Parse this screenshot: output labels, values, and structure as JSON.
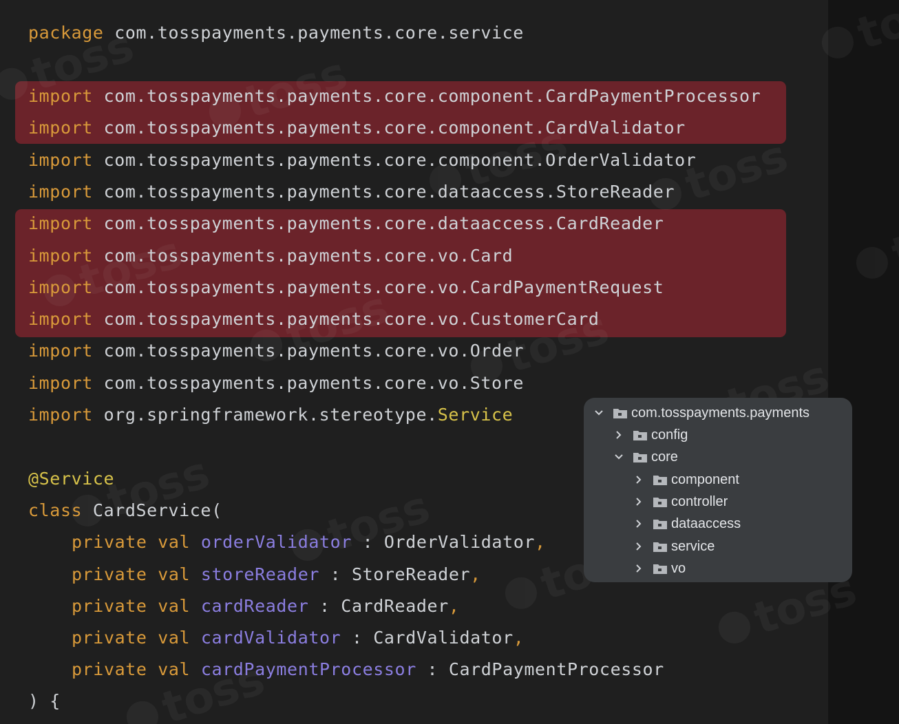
{
  "code": {
    "package_kw": "package",
    "package_name": " com.tosspayments.payments.core.service",
    "imports": [
      {
        "kw": "import",
        "path": " com.tosspayments.payments.core.component.CardPaymentProcessor"
      },
      {
        "kw": "import",
        "path": " com.tosspayments.payments.core.component.CardValidator"
      },
      {
        "kw": "import",
        "path": " com.tosspayments.payments.core.component.OrderValidator"
      },
      {
        "kw": "import",
        "path": " com.tosspayments.payments.core.dataaccess.StoreReader"
      },
      {
        "kw": "import",
        "path": " com.tosspayments.payments.core.dataaccess.CardReader"
      },
      {
        "kw": "import",
        "path": " com.tosspayments.payments.core.vo.Card"
      },
      {
        "kw": "import",
        "path": " com.tosspayments.payments.core.vo.CardPaymentRequest"
      },
      {
        "kw": "import",
        "path": " com.tosspayments.payments.core.vo.CustomerCard"
      },
      {
        "kw": "import",
        "path": " com.tosspayments.payments.core.vo.Order"
      },
      {
        "kw": "import",
        "path": " com.tosspayments.payments.core.vo.Store"
      }
    ],
    "last_import": {
      "kw": "import",
      "path": " org.springframework.stereotype.",
      "annotation": "Service"
    },
    "annotation": "@Service",
    "class_kw": "class",
    "class_decl": " CardService(",
    "params": [
      {
        "mods": "private val",
        "name": "orderValidator",
        "type": " : OrderValidator",
        "trail": ","
      },
      {
        "mods": "private val",
        "name": "storeReader",
        "type": " : StoreReader",
        "trail": ","
      },
      {
        "mods": "private val",
        "name": "cardReader",
        "type": " : CardReader",
        "trail": ","
      },
      {
        "mods": "private val",
        "name": "cardValidator",
        "type": " : CardValidator",
        "trail": ","
      },
      {
        "mods": "private val",
        "name": "cardPaymentProcessor",
        "type": " : CardPaymentProcessor",
        "trail": ""
      }
    ],
    "closing": ") {"
  },
  "highlighted_import_groups": [
    [
      0,
      1
    ],
    [
      4,
      5,
      6,
      7
    ]
  ],
  "project_tree": {
    "root": "com.tosspayments.payments",
    "items": [
      {
        "label": "config",
        "expanded": false
      },
      {
        "label": "core",
        "expanded": true
      },
      {
        "label": "component",
        "expanded": false
      },
      {
        "label": "controller",
        "expanded": false
      },
      {
        "label": "dataaccess",
        "expanded": false
      },
      {
        "label": "service",
        "expanded": false
      },
      {
        "label": "vo",
        "expanded": false
      }
    ]
  },
  "watermark": "toss",
  "colors": {
    "background": "#1f1f1f",
    "highlight": "#6b232a",
    "keyword": "#d99a3a",
    "annotation": "#d8c34a",
    "property": "#8b7ee0",
    "text": "#cfd2d6",
    "tree_panel": "#3a3d40"
  }
}
